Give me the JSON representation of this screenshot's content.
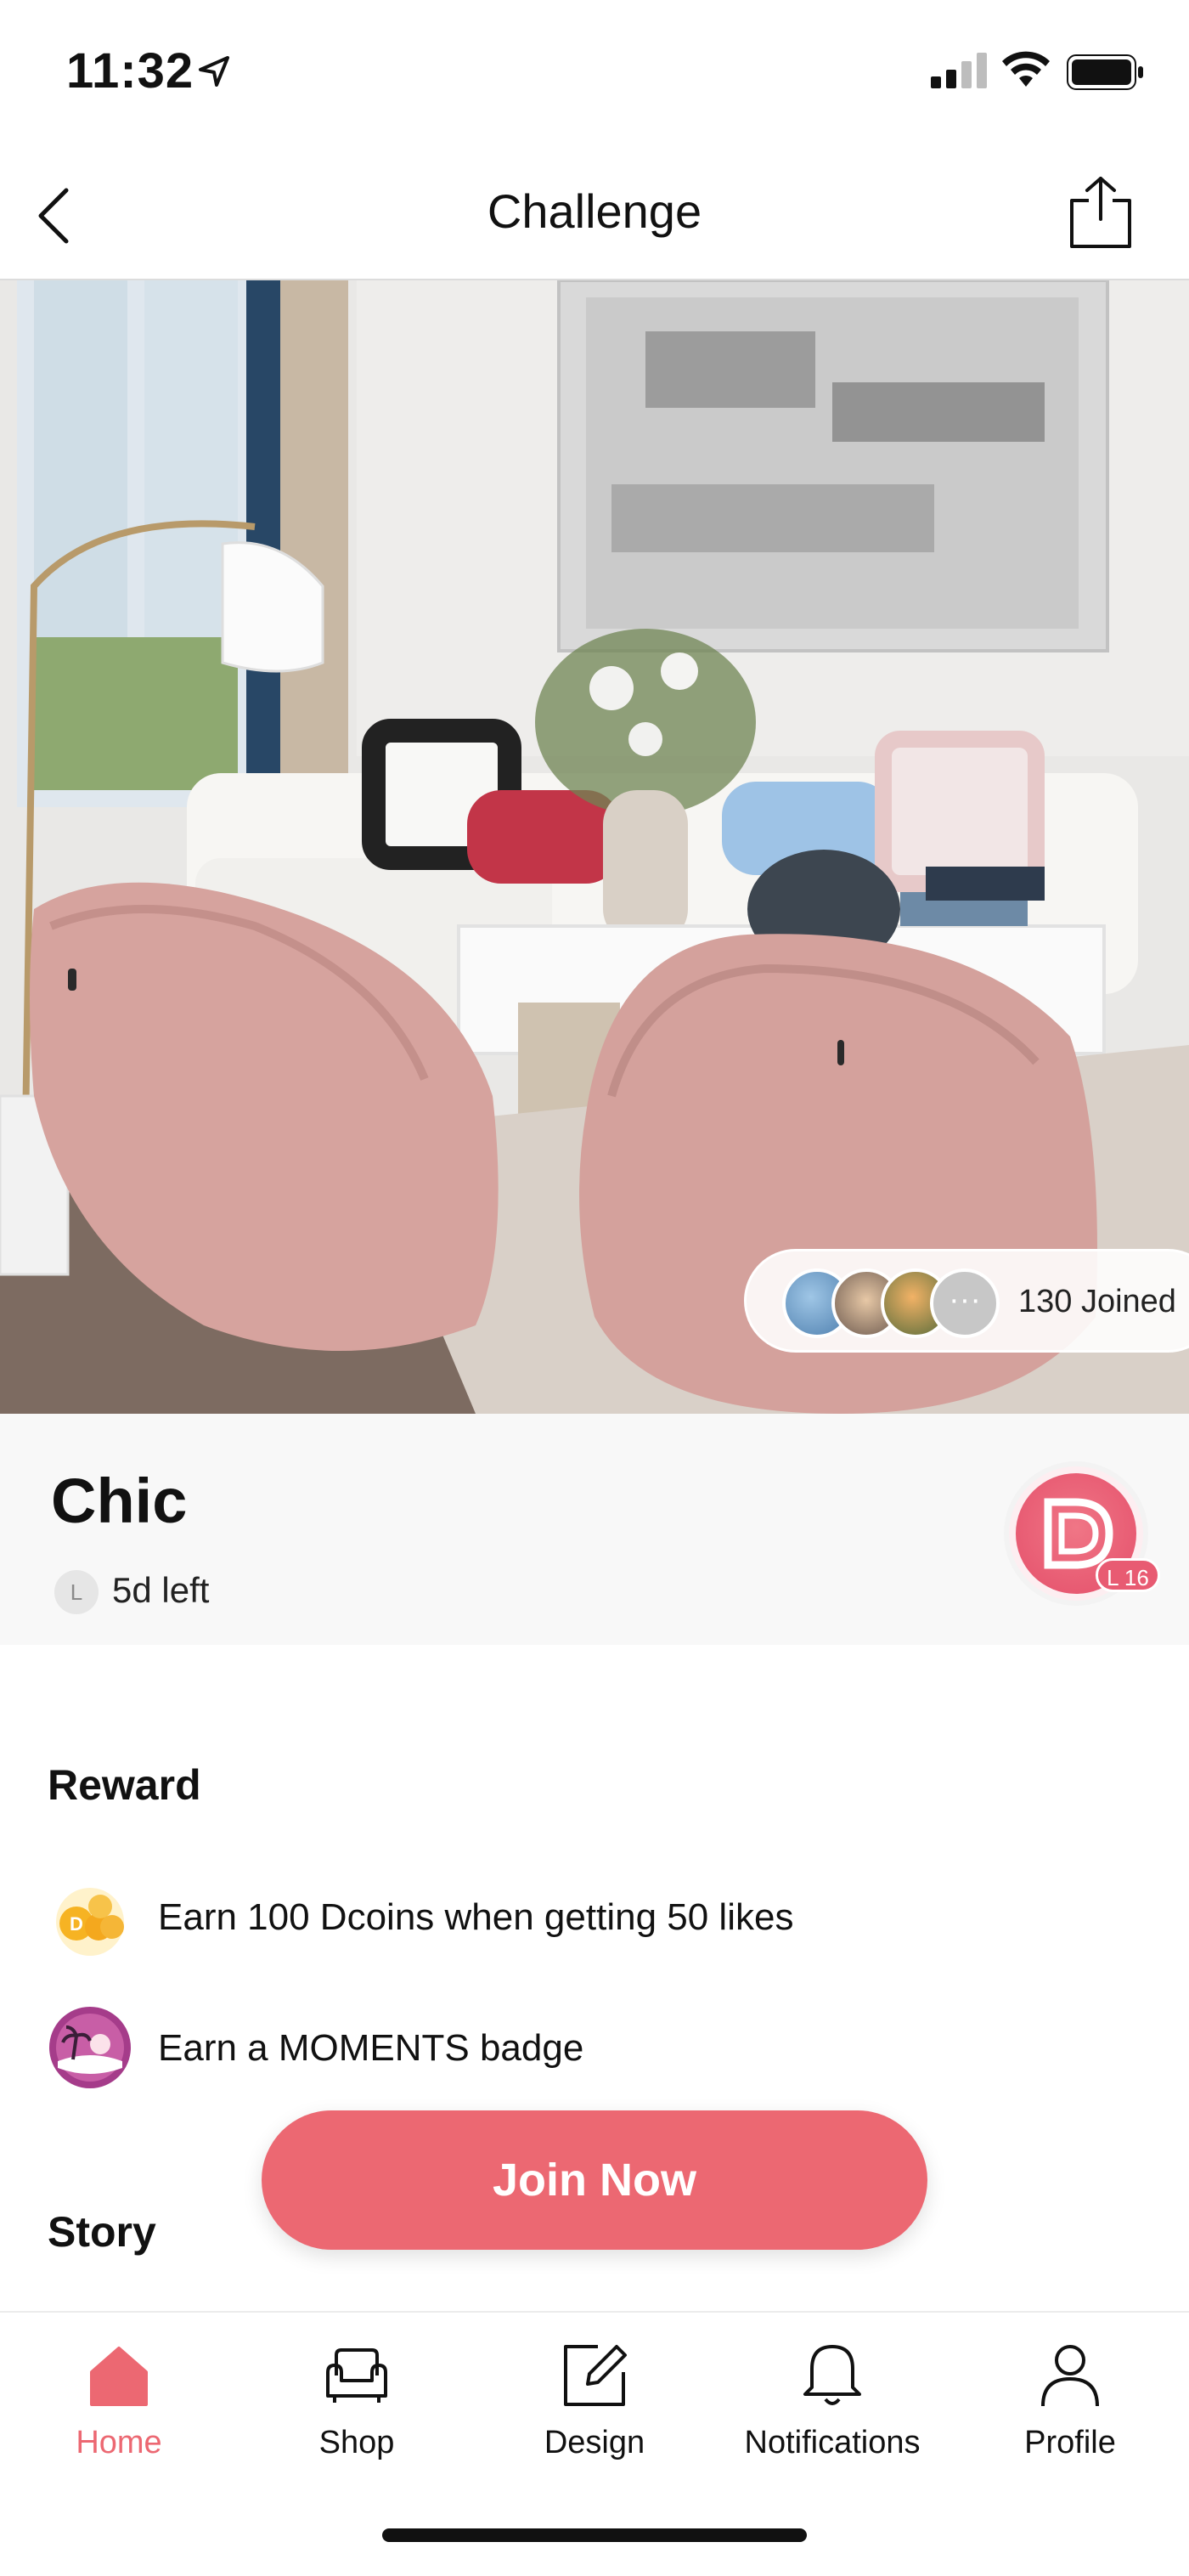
{
  "status_bar": {
    "time": "11:32"
  },
  "header": {
    "title": "Challenge"
  },
  "hero": {
    "joined_text": "130 Joined",
    "more_label": "···"
  },
  "challenge": {
    "name": "Chic",
    "time_left": "5d left",
    "timer_glyph": "L",
    "level_badge": "L 16"
  },
  "reward": {
    "title": "Reward",
    "items": [
      {
        "text": "Earn 100 Dcoins when getting 50 likes",
        "icon": "dcoins-icon"
      },
      {
        "text": "Earn a MOMENTS badge",
        "icon": "moments-badge-icon"
      }
    ]
  },
  "story": {
    "title": "Story"
  },
  "join_button": {
    "label": "Join Now"
  },
  "tab_bar": {
    "items": [
      {
        "label": "Home",
        "icon": "home-icon",
        "active": true
      },
      {
        "label": "Shop",
        "icon": "sofa-icon",
        "active": false
      },
      {
        "label": "Design",
        "icon": "edit-icon",
        "active": false
      },
      {
        "label": "Notifications",
        "icon": "bell-icon",
        "active": false
      },
      {
        "label": "Profile",
        "icon": "person-icon",
        "active": false
      }
    ]
  },
  "colors": {
    "accent": "#ec6872",
    "brand_pink": "#e44f6a",
    "divider": "#dcdcdc"
  }
}
